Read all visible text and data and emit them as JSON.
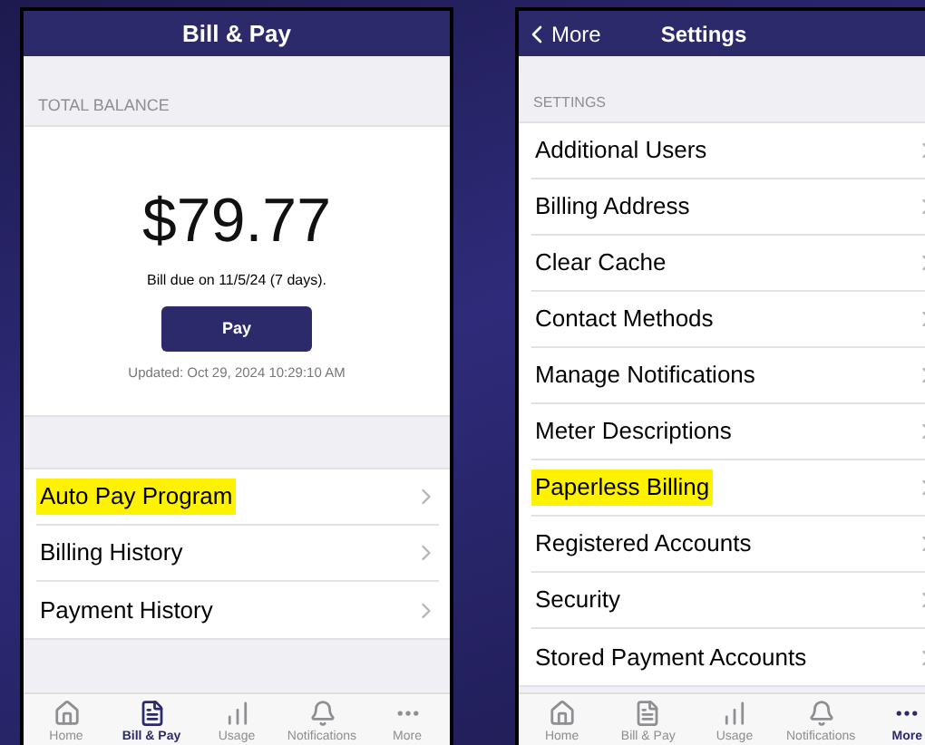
{
  "bill_screen": {
    "title": "Bill & Pay",
    "section_label": "TOTAL BALANCE",
    "amount": "$79.77",
    "due": "Bill due on 11/5/24 (7 days).",
    "pay_button": "Pay",
    "updated": "Updated: Oct 29, 2024 10:29:10 AM",
    "items": [
      {
        "label": "Auto Pay Program",
        "highlighted": true
      },
      {
        "label": "Billing History",
        "highlighted": false
      },
      {
        "label": "Payment History",
        "highlighted": false
      }
    ],
    "tabs": [
      {
        "label": "Home",
        "kind": "home",
        "selected": false
      },
      {
        "label": "Bill & Pay",
        "kind": "bill",
        "selected": true
      },
      {
        "label": "Usage",
        "kind": "usage",
        "selected": false
      },
      {
        "label": "Notifications",
        "kind": "notifications",
        "selected": false
      },
      {
        "label": "More",
        "kind": "more",
        "selected": false
      }
    ]
  },
  "settings_screen": {
    "back": "More",
    "title": "Settings",
    "section_label": "SETTINGS",
    "items": [
      {
        "label": "Additional Users",
        "highlighted": false
      },
      {
        "label": "Billing Address",
        "highlighted": false
      },
      {
        "label": "Clear Cache",
        "highlighted": false
      },
      {
        "label": "Contact Methods",
        "highlighted": false
      },
      {
        "label": "Manage Notifications",
        "highlighted": false
      },
      {
        "label": "Meter Descriptions",
        "highlighted": false
      },
      {
        "label": "Paperless Billing",
        "highlighted": true
      },
      {
        "label": "Registered Accounts",
        "highlighted": false
      },
      {
        "label": "Security",
        "highlighted": false
      },
      {
        "label": "Stored Payment Accounts",
        "highlighted": false
      }
    ],
    "tabs": [
      {
        "label": "Home",
        "kind": "home",
        "selected": false
      },
      {
        "label": "Bill & Pay",
        "kind": "bill",
        "selected": false
      },
      {
        "label": "Usage",
        "kind": "usage",
        "selected": false
      },
      {
        "label": "Notifications",
        "kind": "notifications",
        "selected": false
      },
      {
        "label": "More",
        "kind": "more",
        "selected": true
      }
    ]
  }
}
